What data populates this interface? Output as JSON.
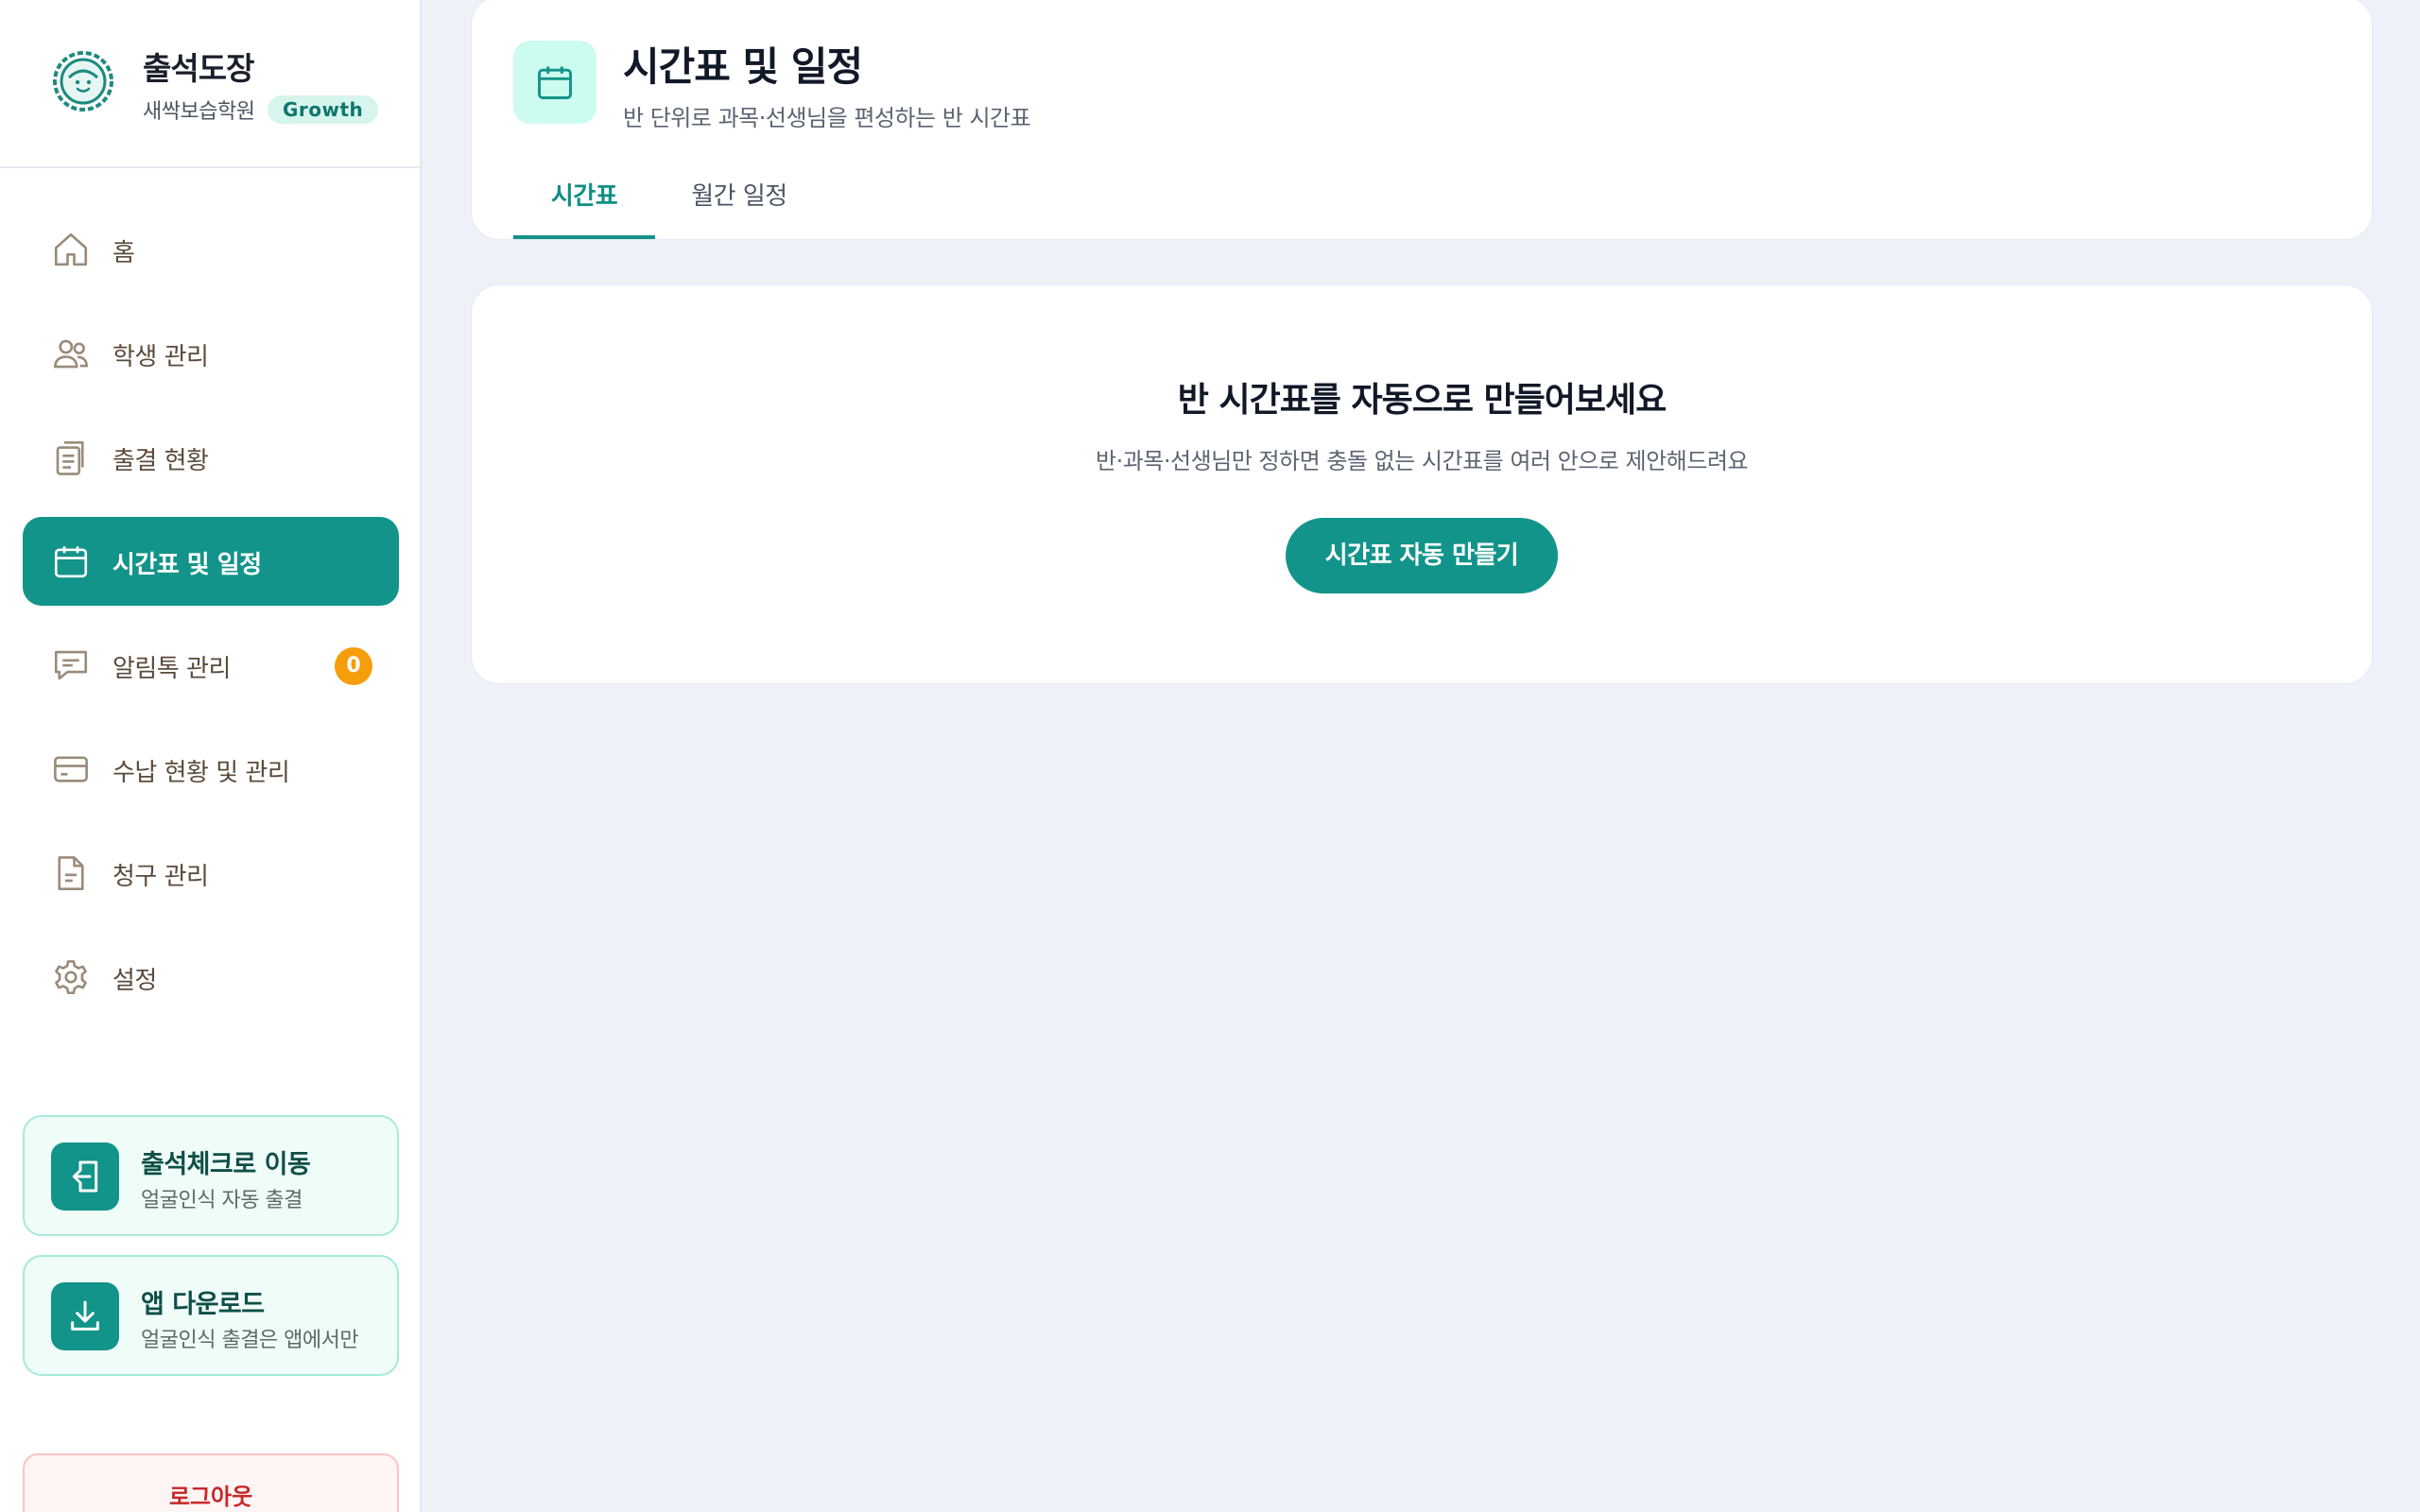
{
  "brand": {
    "name": "출석도장",
    "academy": "새싹보습학원",
    "plan": "Growth"
  },
  "sidebar": {
    "items": [
      {
        "label": "홈",
        "icon": "home-icon"
      },
      {
        "label": "학생 관리",
        "icon": "users-icon"
      },
      {
        "label": "출결 현황",
        "icon": "clipboard-icon"
      },
      {
        "label": "시간표 및 일정",
        "icon": "calendar-icon",
        "active": true
      },
      {
        "label": "알림톡 관리",
        "icon": "message-icon",
        "count": "0"
      },
      {
        "label": "수납 현황 및 관리",
        "icon": "credit-card-icon"
      },
      {
        "label": "청구 관리",
        "icon": "document-icon"
      },
      {
        "label": "설정",
        "icon": "gear-icon"
      }
    ],
    "promos": [
      {
        "title": "출석체크로 이동",
        "subtitle": "얼굴인식 자동 출결",
        "icon": "enter-icon"
      },
      {
        "title": "앱 다운로드",
        "subtitle": "얼굴인식 출결은 앱에서만",
        "icon": "download-icon"
      }
    ],
    "logout_label": "로그아웃"
  },
  "header": {
    "title": "시간표 및 일정",
    "subtitle": "반 단위로 과목·선생님을 편성하는 반 시간표",
    "tabs": [
      {
        "label": "시간표",
        "active": true
      },
      {
        "label": "월간 일정",
        "active": false
      }
    ]
  },
  "empty_state": {
    "title": "반 시간표를 자동으로 만들어보세요",
    "description": "반·과목·선생님만 정하면 충돌 없는 시간표를 여러 안으로 제안해드려요",
    "button_label": "시간표 자동 만들기"
  },
  "colors": {
    "accent": "#13948a",
    "accent_light": "#ccfbef",
    "badge_orange": "#f59e0b",
    "logout_red": "#c62828",
    "background": "#eef1f8"
  }
}
